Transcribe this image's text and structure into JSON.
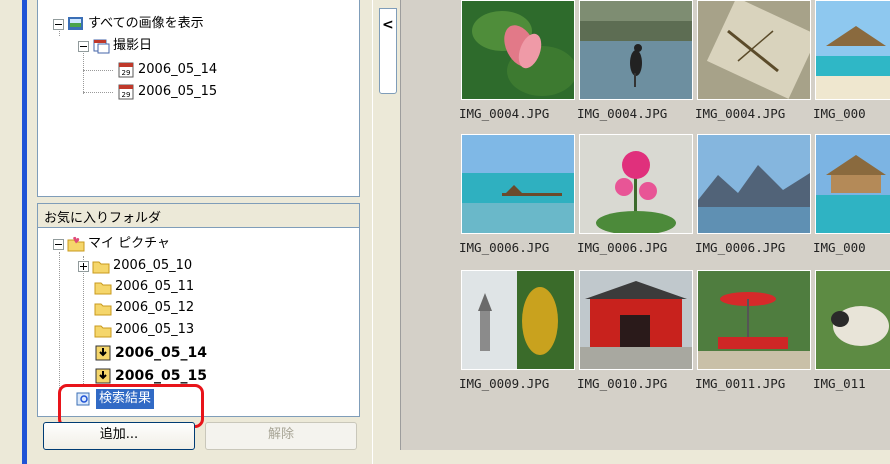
{
  "tree_top": {
    "root_label": "すべての画像を表示",
    "date_group_label": "撮影日",
    "dates": [
      "2006_05_14",
      "2006_05_15"
    ]
  },
  "favorites": {
    "header": "お気に入りフォルダ",
    "root_label": "マイ ピクチャ",
    "folders": [
      "2006_05_10",
      "2006_05_11",
      "2006_05_12",
      "2006_05_13"
    ],
    "bold_folders": [
      "2006_05_14",
      "2006_05_15"
    ],
    "search_result_label": "検索結果"
  },
  "buttons": {
    "add": "追加...",
    "remove": "解除"
  },
  "collapse_glyph": "<",
  "thumbnails": {
    "row1": [
      "IMG_0004.JPG",
      "IMG_0004.JPG",
      "IMG_0004.JPG",
      "IMG_000"
    ],
    "row2": [
      "IMG_0006.JPG",
      "IMG_0006.JPG",
      "IMG_0006.JPG",
      "IMG_000"
    ],
    "row3": [
      "IMG_0009.JPG",
      "IMG_0010.JPG",
      "IMG_0011.JPG",
      "IMG_011"
    ]
  },
  "colors": {
    "accent_blue": "#316ac5",
    "highlight_red": "#e8141a"
  }
}
